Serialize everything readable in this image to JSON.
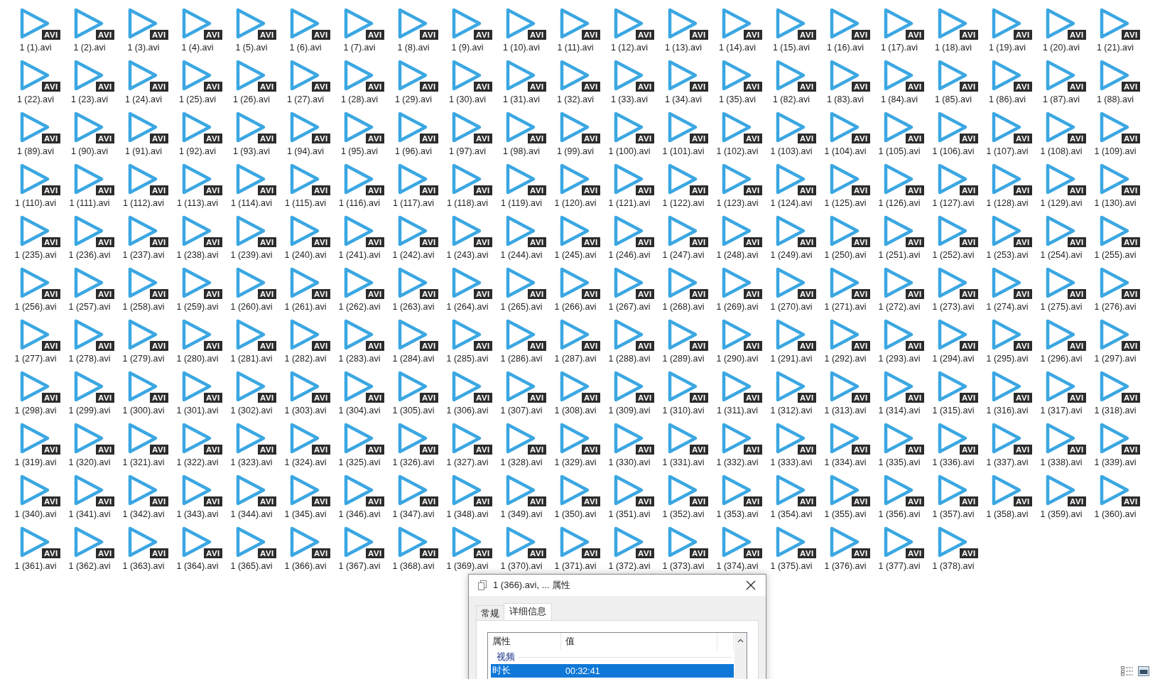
{
  "files": [
    {
      "name": "1 (1).avi",
      "badge": "AVI"
    },
    {
      "name": "1 (2).avi",
      "badge": "AVI"
    },
    {
      "name": "1 (3).avi",
      "badge": "AVI"
    },
    {
      "name": "1 (4).avi",
      "badge": "AVI"
    },
    {
      "name": "1 (5).avi",
      "badge": "AVI"
    },
    {
      "name": "1 (6).avi",
      "badge": "AVI"
    },
    {
      "name": "1 (7).avi",
      "badge": "AVI"
    },
    {
      "name": "1 (8).avi",
      "badge": "AVI"
    },
    {
      "name": "1 (9).avi",
      "badge": "AVI"
    },
    {
      "name": "1 (10).avi",
      "badge": "AVI"
    },
    {
      "name": "1 (11).avi",
      "badge": "AVI"
    },
    {
      "name": "1 (12).avi",
      "badge": "AVI"
    },
    {
      "name": "1 (13).avi",
      "badge": "AVI"
    },
    {
      "name": "1 (14).avi",
      "badge": "AVI"
    },
    {
      "name": "1 (15).avi",
      "badge": "AVI"
    },
    {
      "name": "1 (16).avi",
      "badge": "AVI"
    },
    {
      "name": "1 (17).avi",
      "badge": "AVI"
    },
    {
      "name": "1 (18).avi",
      "badge": "AVI"
    },
    {
      "name": "1 (19).avi",
      "badge": "AVI"
    },
    {
      "name": "1 (20).avi",
      "badge": "AVI"
    },
    {
      "name": "1 (21).avi",
      "badge": "AVI"
    },
    {
      "name": "1 (22).avi",
      "badge": "AVI"
    },
    {
      "name": "1 (23).avi",
      "badge": "AVI"
    },
    {
      "name": "1 (24).avi",
      "badge": "AVI"
    },
    {
      "name": "1 (25).avi",
      "badge": "AVI"
    },
    {
      "name": "1 (26).avi",
      "badge": "AVI"
    },
    {
      "name": "1 (27).avi",
      "badge": "AVI"
    },
    {
      "name": "1 (28).avi",
      "badge": "AVI"
    },
    {
      "name": "1 (29).avi",
      "badge": "AVI"
    },
    {
      "name": "1 (30).avi",
      "badge": "AVI"
    },
    {
      "name": "1 (31).avi",
      "badge": "AVI"
    },
    {
      "name": "1 (32).avi",
      "badge": "AVI"
    },
    {
      "name": "1 (33).avi",
      "badge": "AVI"
    },
    {
      "name": "1 (34).avi",
      "badge": "AVI"
    },
    {
      "name": "1 (35).avi",
      "badge": "AVI"
    },
    {
      "name": "1 (82).avi",
      "badge": "AVI"
    },
    {
      "name": "1 (83).avi",
      "badge": "AVI"
    },
    {
      "name": "1 (84).avi",
      "badge": "AVI"
    },
    {
      "name": "1 (85).avi",
      "badge": "AVI"
    },
    {
      "name": "1 (86).avi",
      "badge": "AVI"
    },
    {
      "name": "1 (87).avi",
      "badge": "AVI"
    },
    {
      "name": "1 (88).avi",
      "badge": "AVI"
    },
    {
      "name": "1 (89).avi",
      "badge": "AVI"
    },
    {
      "name": "1 (90).avi",
      "badge": "AVI"
    },
    {
      "name": "1 (91).avi",
      "badge": "AVI"
    },
    {
      "name": "1 (92).avi",
      "badge": "AVI"
    },
    {
      "name": "1 (93).avi",
      "badge": "AVI"
    },
    {
      "name": "1 (94).avi",
      "badge": "AVI"
    },
    {
      "name": "1 (95).avi",
      "badge": "AVI"
    },
    {
      "name": "1 (96).avi",
      "badge": "AVI"
    },
    {
      "name": "1 (97).avi",
      "badge": "AVI"
    },
    {
      "name": "1 (98).avi",
      "badge": "AVI"
    },
    {
      "name": "1 (99).avi",
      "badge": "AVI"
    },
    {
      "name": "1 (100).avi",
      "badge": "AVI"
    },
    {
      "name": "1 (101).avi",
      "badge": "AVI"
    },
    {
      "name": "1 (102).avi",
      "badge": "AVI"
    },
    {
      "name": "1 (103).avi",
      "badge": "AVI"
    },
    {
      "name": "1 (104).avi",
      "badge": "AVI"
    },
    {
      "name": "1 (105).avi",
      "badge": "AVI"
    },
    {
      "name": "1 (106).avi",
      "badge": "AVI"
    },
    {
      "name": "1 (107).avi",
      "badge": "AVI"
    },
    {
      "name": "1 (108).avi",
      "badge": "AVI"
    },
    {
      "name": "1 (109).avi",
      "badge": "AVI"
    },
    {
      "name": "1 (110).avi",
      "badge": "AVI"
    },
    {
      "name": "1 (111).avi",
      "badge": "AVI"
    },
    {
      "name": "1 (112).avi",
      "badge": "AVI"
    },
    {
      "name": "1 (113).avi",
      "badge": "AVI"
    },
    {
      "name": "1 (114).avi",
      "badge": "AVI"
    },
    {
      "name": "1 (115).avi",
      "badge": "AVI"
    },
    {
      "name": "1 (116).avi",
      "badge": "AVI"
    },
    {
      "name": "1 (117).avi",
      "badge": "AVI"
    },
    {
      "name": "1 (118).avi",
      "badge": "AVI"
    },
    {
      "name": "1 (119).avi",
      "badge": "AVI"
    },
    {
      "name": "1 (120).avi",
      "badge": "AVI"
    },
    {
      "name": "1 (121).avi",
      "badge": "AVI"
    },
    {
      "name": "1 (122).avi",
      "badge": "AVI"
    },
    {
      "name": "1 (123).avi",
      "badge": "AVI"
    },
    {
      "name": "1 (124).avi",
      "badge": "AVI"
    },
    {
      "name": "1 (125).avi",
      "badge": "AVI"
    },
    {
      "name": "1 (126).avi",
      "badge": "AVI"
    },
    {
      "name": "1 (127).avi",
      "badge": "AVI"
    },
    {
      "name": "1 (128).avi",
      "badge": "AVI"
    },
    {
      "name": "1 (129).avi",
      "badge": "AVI"
    },
    {
      "name": "1 (130).avi",
      "badge": "AVI"
    },
    {
      "name": "1 (235).avi",
      "badge": "AVI"
    },
    {
      "name": "1 (236).avi",
      "badge": "AVI"
    },
    {
      "name": "1 (237).avi",
      "badge": "AVI"
    },
    {
      "name": "1 (238).avi",
      "badge": "AVI"
    },
    {
      "name": "1 (239).avi",
      "badge": "AVI"
    },
    {
      "name": "1 (240).avi",
      "badge": "AVI"
    },
    {
      "name": "1 (241).avi",
      "badge": "AVI"
    },
    {
      "name": "1 (242).avi",
      "badge": "AVI"
    },
    {
      "name": "1 (243).avi",
      "badge": "AVI"
    },
    {
      "name": "1 (244).avi",
      "badge": "AVI"
    },
    {
      "name": "1 (245).avi",
      "badge": "AVI"
    },
    {
      "name": "1 (246).avi",
      "badge": "AVI"
    },
    {
      "name": "1 (247).avi",
      "badge": "AVI"
    },
    {
      "name": "1 (248).avi",
      "badge": "AVI"
    },
    {
      "name": "1 (249).avi",
      "badge": "AVI"
    },
    {
      "name": "1 (250).avi",
      "badge": "AVI"
    },
    {
      "name": "1 (251).avi",
      "badge": "AVI"
    },
    {
      "name": "1 (252).avi",
      "badge": "AVI"
    },
    {
      "name": "1 (253).avi",
      "badge": "AVI"
    },
    {
      "name": "1 (254).avi",
      "badge": "AVI"
    },
    {
      "name": "1 (255).avi",
      "badge": "AVI"
    },
    {
      "name": "1 (256).avi",
      "badge": "AVI"
    },
    {
      "name": "1 (257).avi",
      "badge": "AVI"
    },
    {
      "name": "1 (258).avi",
      "badge": "AVI"
    },
    {
      "name": "1 (259).avi",
      "badge": "AVI"
    },
    {
      "name": "1 (260).avi",
      "badge": "AVI"
    },
    {
      "name": "1 (261).avi",
      "badge": "AVI"
    },
    {
      "name": "1 (262).avi",
      "badge": "AVI"
    },
    {
      "name": "1 (263).avi",
      "badge": "AVI"
    },
    {
      "name": "1 (264).avi",
      "badge": "AVI"
    },
    {
      "name": "1 (265).avi",
      "badge": "AVI"
    },
    {
      "name": "1 (266).avi",
      "badge": "AVI"
    },
    {
      "name": "1 (267).avi",
      "badge": "AVI"
    },
    {
      "name": "1 (268).avi",
      "badge": "AVI"
    },
    {
      "name": "1 (269).avi",
      "badge": "AVI"
    },
    {
      "name": "1 (270).avi",
      "badge": "AVI"
    },
    {
      "name": "1 (271).avi",
      "badge": "AVI"
    },
    {
      "name": "1 (272).avi",
      "badge": "AVI"
    },
    {
      "name": "1 (273).avi",
      "badge": "AVI"
    },
    {
      "name": "1 (274).avi",
      "badge": "AVI"
    },
    {
      "name": "1 (275).avi",
      "badge": "AVI"
    },
    {
      "name": "1 (276).avi",
      "badge": "AVI"
    },
    {
      "name": "1 (277).avi",
      "badge": "AVI"
    },
    {
      "name": "1 (278).avi",
      "badge": "AVI"
    },
    {
      "name": "1 (279).avi",
      "badge": "AVI"
    },
    {
      "name": "1 (280).avi",
      "badge": "AVI"
    },
    {
      "name": "1 (281).avi",
      "badge": "AVI"
    },
    {
      "name": "1 (282).avi",
      "badge": "AVI"
    },
    {
      "name": "1 (283).avi",
      "badge": "AVI"
    },
    {
      "name": "1 (284).avi",
      "badge": "AVI"
    },
    {
      "name": "1 (285).avi",
      "badge": "AVI"
    },
    {
      "name": "1 (286).avi",
      "badge": "AVI"
    },
    {
      "name": "1 (287).avi",
      "badge": "AVI"
    },
    {
      "name": "1 (288).avi",
      "badge": "AVI"
    },
    {
      "name": "1 (289).avi",
      "badge": "AVI"
    },
    {
      "name": "1 (290).avi",
      "badge": "AVI"
    },
    {
      "name": "1 (291).avi",
      "badge": "AVI"
    },
    {
      "name": "1 (292).avi",
      "badge": "AVI"
    },
    {
      "name": "1 (293).avi",
      "badge": "AVI"
    },
    {
      "name": "1 (294).avi",
      "badge": "AVI"
    },
    {
      "name": "1 (295).avi",
      "badge": "AVI"
    },
    {
      "name": "1 (296).avi",
      "badge": "AVI"
    },
    {
      "name": "1 (297).avi",
      "badge": "AVI"
    },
    {
      "name": "1 (298).avi",
      "badge": "AVI"
    },
    {
      "name": "1 (299).avi",
      "badge": "AVI"
    },
    {
      "name": "1 (300).avi",
      "badge": "AVI"
    },
    {
      "name": "1 (301).avi",
      "badge": "AVI"
    },
    {
      "name": "1 (302).avi",
      "badge": "AVI"
    },
    {
      "name": "1 (303).avi",
      "badge": "AVI"
    },
    {
      "name": "1 (304).avi",
      "badge": "AVI"
    },
    {
      "name": "1 (305).avi",
      "badge": "AVI"
    },
    {
      "name": "1 (306).avi",
      "badge": "AVI"
    },
    {
      "name": "1 (307).avi",
      "badge": "AVI"
    },
    {
      "name": "1 (308).avi",
      "badge": "AVI"
    },
    {
      "name": "1 (309).avi",
      "badge": "AVI"
    },
    {
      "name": "1 (310).avi",
      "badge": "AVI"
    },
    {
      "name": "1 (311).avi",
      "badge": "AVI"
    },
    {
      "name": "1 (312).avi",
      "badge": "AVI"
    },
    {
      "name": "1 (313).avi",
      "badge": "AVI"
    },
    {
      "name": "1 (314).avi",
      "badge": "AVI"
    },
    {
      "name": "1 (315).avi",
      "badge": "AVI"
    },
    {
      "name": "1 (316).avi",
      "badge": "AVI"
    },
    {
      "name": "1 (317).avi",
      "badge": "AVI"
    },
    {
      "name": "1 (318).avi",
      "badge": "AVI"
    },
    {
      "name": "1 (319).avi",
      "badge": "AVI"
    },
    {
      "name": "1 (320).avi",
      "badge": "AVI"
    },
    {
      "name": "1 (321).avi",
      "badge": "AVI"
    },
    {
      "name": "1 (322).avi",
      "badge": "AVI"
    },
    {
      "name": "1 (323).avi",
      "badge": "AVI"
    },
    {
      "name": "1 (324).avi",
      "badge": "AVI"
    },
    {
      "name": "1 (325).avi",
      "badge": "AVI"
    },
    {
      "name": "1 (326).avi",
      "badge": "AVI"
    },
    {
      "name": "1 (327).avi",
      "badge": "AVI"
    },
    {
      "name": "1 (328).avi",
      "badge": "AVI"
    },
    {
      "name": "1 (329).avi",
      "badge": "AVI"
    },
    {
      "name": "1 (330).avi",
      "badge": "AVI"
    },
    {
      "name": "1 (331).avi",
      "badge": "AVI"
    },
    {
      "name": "1 (332).avi",
      "badge": "AVI"
    },
    {
      "name": "1 (333).avi",
      "badge": "AVI"
    },
    {
      "name": "1 (334).avi",
      "badge": "AVI"
    },
    {
      "name": "1 (335).avi",
      "badge": "AVI"
    },
    {
      "name": "1 (336).avi",
      "badge": "AVI"
    },
    {
      "name": "1 (337).avi",
      "badge": "AVI"
    },
    {
      "name": "1 (338).avi",
      "badge": "AVI"
    },
    {
      "name": "1 (339).avi",
      "badge": "AVI"
    },
    {
      "name": "1 (340).avi",
      "badge": "AVI"
    },
    {
      "name": "1 (341).avi",
      "badge": "AVI"
    },
    {
      "name": "1 (342).avi",
      "badge": "AVI"
    },
    {
      "name": "1 (343).avi",
      "badge": "AVI"
    },
    {
      "name": "1 (344).avi",
      "badge": "AVI"
    },
    {
      "name": "1 (345).avi",
      "badge": "AVI"
    },
    {
      "name": "1 (346).avi",
      "badge": "AVI"
    },
    {
      "name": "1 (347).avi",
      "badge": "AVI"
    },
    {
      "name": "1 (348).avi",
      "badge": "AVI"
    },
    {
      "name": "1 (349).avi",
      "badge": "AVI"
    },
    {
      "name": "1 (350).avi",
      "badge": "AVI"
    },
    {
      "name": "1 (351).avi",
      "badge": "AVI"
    },
    {
      "name": "1 (352).avi",
      "badge": "AVI"
    },
    {
      "name": "1 (353).avi",
      "badge": "AVI"
    },
    {
      "name": "1 (354).avi",
      "badge": "AVI"
    },
    {
      "name": "1 (355).avi",
      "badge": "AVI"
    },
    {
      "name": "1 (356).avi",
      "badge": "AVI"
    },
    {
      "name": "1 (357).avi",
      "badge": "AVI"
    },
    {
      "name": "1 (358).avi",
      "badge": "AVI"
    },
    {
      "name": "1 (359).avi",
      "badge": "AVI"
    },
    {
      "name": "1 (360).avi",
      "badge": "AVI"
    },
    {
      "name": "1 (361).avi",
      "badge": "AVI"
    },
    {
      "name": "1 (362).avi",
      "badge": "AVI"
    },
    {
      "name": "1 (363).avi",
      "badge": "AVI"
    },
    {
      "name": "1 (364).avi",
      "badge": "AVI"
    },
    {
      "name": "1 (365).avi",
      "badge": "AVI"
    },
    {
      "name": "1 (366).avi",
      "badge": "AVI"
    },
    {
      "name": "1 (367).avi",
      "badge": "AVI"
    },
    {
      "name": "1 (368).avi",
      "badge": "AVI"
    },
    {
      "name": "1 (369).avi",
      "badge": "AVI"
    },
    {
      "name": "1 (370).avi",
      "badge": "AVI"
    },
    {
      "name": "1 (371).avi",
      "badge": "AVI"
    },
    {
      "name": "1 (372).avi",
      "badge": "AVI"
    },
    {
      "name": "1 (373).avi",
      "badge": "AVI"
    },
    {
      "name": "1 (374).avi",
      "badge": "AVI"
    },
    {
      "name": "1 (375).avi",
      "badge": "AVI"
    },
    {
      "name": "1 (376).avi",
      "badge": "AVI"
    },
    {
      "name": "1 (377).avi",
      "badge": "AVI"
    },
    {
      "name": "1 (378).avi",
      "badge": "AVI"
    }
  ],
  "dialog": {
    "title": "1 (366).avi, ... 属性",
    "tabs": [
      {
        "label": "常规",
        "selected": false
      },
      {
        "label": "详细信息",
        "selected": true
      }
    ],
    "columns": [
      "属性",
      "值"
    ],
    "group": "视频",
    "rows": [
      {
        "property": "时长",
        "value": "00:32:41",
        "selected": true
      }
    ]
  }
}
